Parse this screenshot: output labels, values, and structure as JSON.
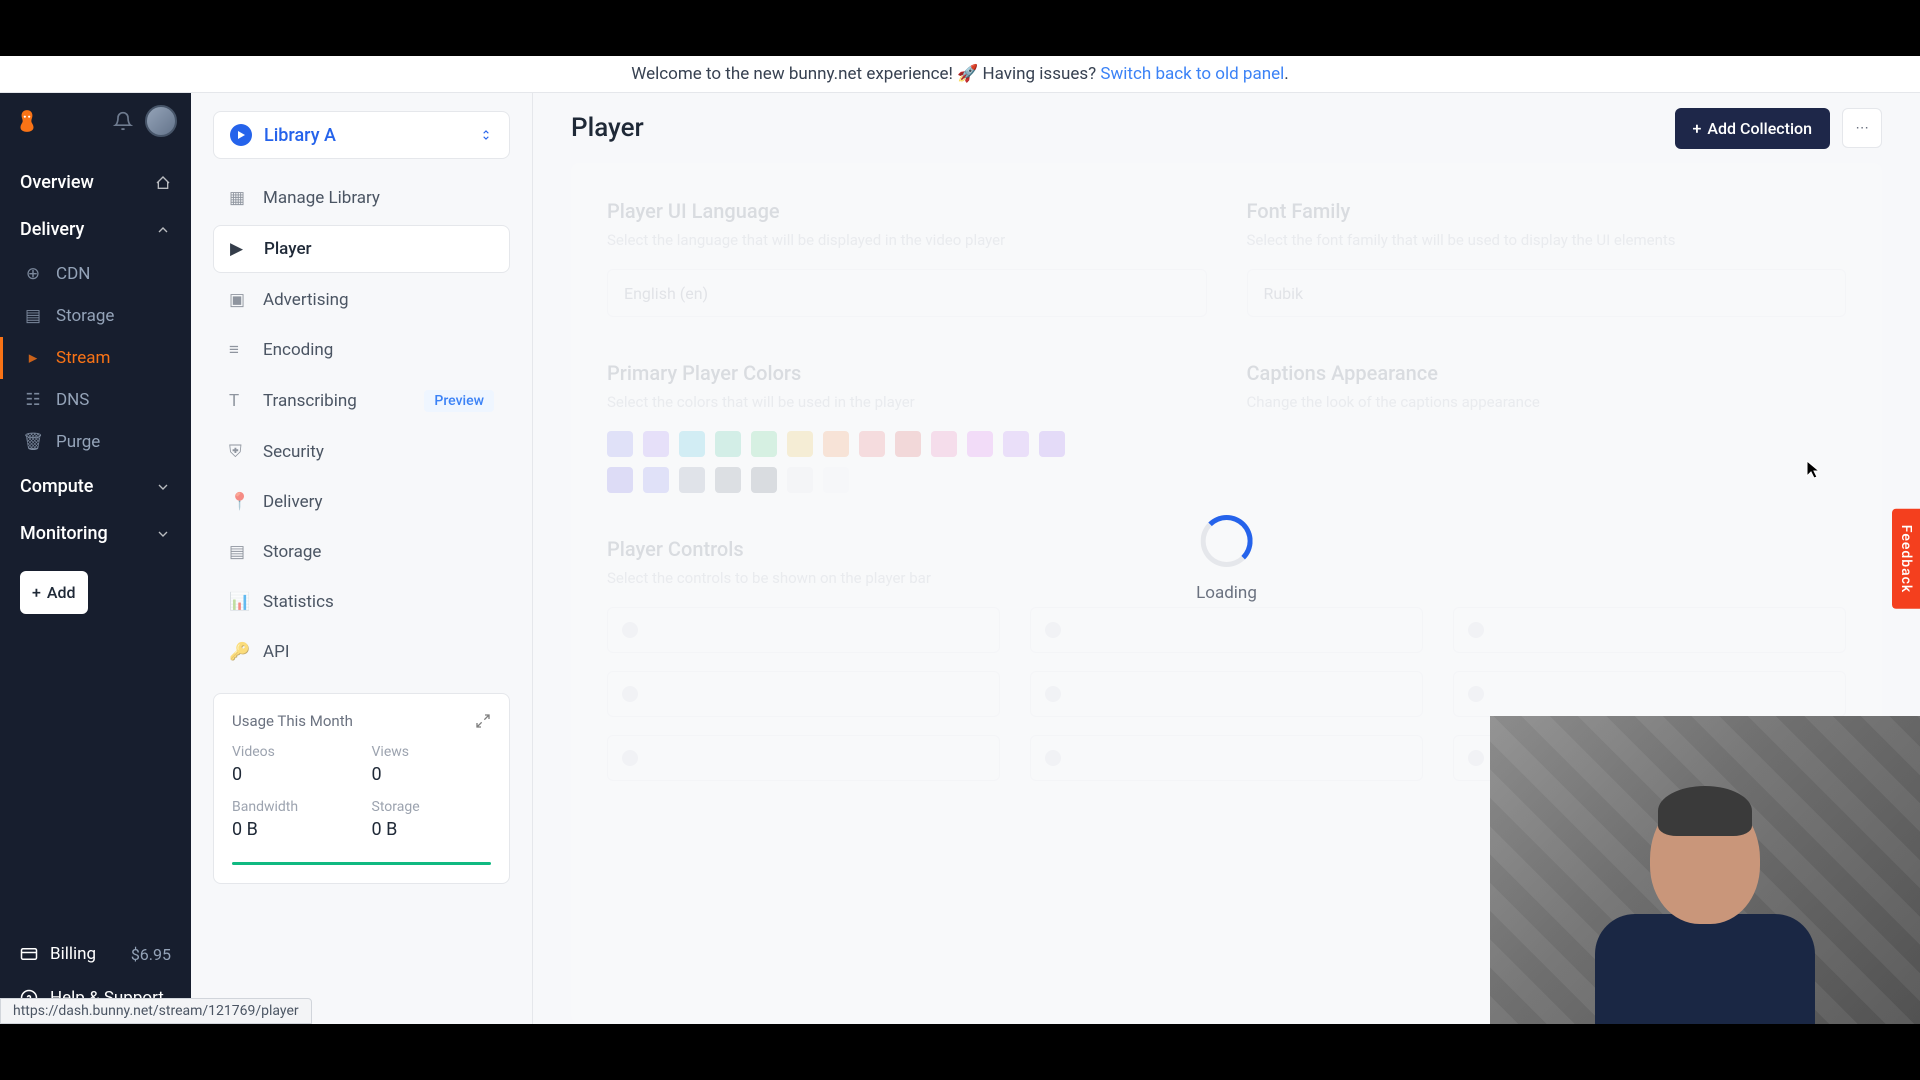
{
  "banner": {
    "text_pre": "Welcome to the new bunny.net experience! 🚀 Having issues? ",
    "link": "Switch back to old panel",
    "text_post": "."
  },
  "sidebar": {
    "groups": {
      "overview": "Overview",
      "delivery": "Delivery",
      "compute": "Compute",
      "monitoring": "Monitoring"
    },
    "delivery_items": [
      "CDN",
      "Storage",
      "Stream",
      "DNS",
      "Purge"
    ],
    "add_button": "Add",
    "billing": {
      "label": "Billing",
      "amount": "$6.95"
    },
    "help": "Help & Support"
  },
  "subnav": {
    "library": "Library A",
    "items": [
      {
        "label": "Manage Library"
      },
      {
        "label": "Player"
      },
      {
        "label": "Advertising"
      },
      {
        "label": "Encoding"
      },
      {
        "label": "Transcribing",
        "badge": "Preview"
      },
      {
        "label": "Security"
      },
      {
        "label": "Delivery"
      },
      {
        "label": "Storage"
      },
      {
        "label": "Statistics"
      },
      {
        "label": "API"
      }
    ],
    "usage": {
      "title": "Usage This Month",
      "cells": [
        {
          "label": "Videos",
          "value": "0"
        },
        {
          "label": "Views",
          "value": "0"
        },
        {
          "label": "Bandwidth",
          "value": "0 B"
        },
        {
          "label": "Storage",
          "value": "0 B"
        }
      ]
    }
  },
  "content": {
    "title": "Player",
    "add_collection": "Add Collection",
    "loading": "Loading",
    "ghost": {
      "lang_title": "Player UI Language",
      "lang_sub": "Select the language that will be displayed in the video player",
      "lang_value": "English (en)",
      "font_title": "Font Family",
      "font_sub": "Select the font family that will be used to display the UI elements",
      "font_value": "Rubik",
      "colors_title": "Primary Player Colors",
      "colors_sub": "Select the colors that will be used in the player",
      "captions_title": "Captions Appearance",
      "captions_sub": "Change the look of the captions appearance",
      "controls_title": "Player Controls",
      "controls_sub": "Select the controls to be shown on the player bar"
    }
  },
  "feedback": "Feedback",
  "status_url": "https://dash.bunny.net/stream/121769/player"
}
